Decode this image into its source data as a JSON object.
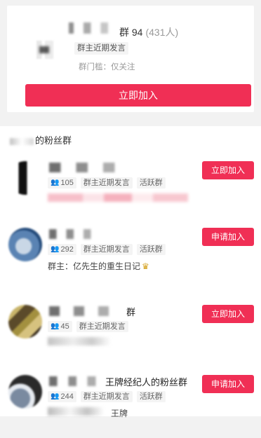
{
  "top": {
    "title_visible": "群 94",
    "count": "(431人)",
    "tag": "群主近期发言",
    "sub": "群门槛：仅关注",
    "join_label": "立即加入"
  },
  "section": {
    "title": "的粉丝群"
  },
  "groups": [
    {
      "name_visible": "",
      "count": "105",
      "tags": [
        "群主近期发言",
        "活跃群"
      ],
      "owner": "",
      "button": "立即加入"
    },
    {
      "name_visible": "",
      "count": "292",
      "tags": [
        "群主近期发言",
        "活跃群"
      ],
      "owner": "群主：亿先生的重生日记",
      "button": "申请加入"
    },
    {
      "name_visible": "群",
      "count": "45",
      "tags": [
        "群主近期发言"
      ],
      "owner": "",
      "button": "立即加入"
    },
    {
      "name_visible": "王牌经纪人的粉丝群",
      "count": "244",
      "tags": [
        "群主近期发言",
        "活跃群"
      ],
      "owner": "王牌",
      "button": "申请加入"
    }
  ],
  "colors": {
    "accent": "#f02f55",
    "page_bg": "#f2f2f2",
    "tag_bg": "#f4f4f4"
  },
  "icons": {
    "member": "people-icon",
    "crown": "crown-icon"
  }
}
